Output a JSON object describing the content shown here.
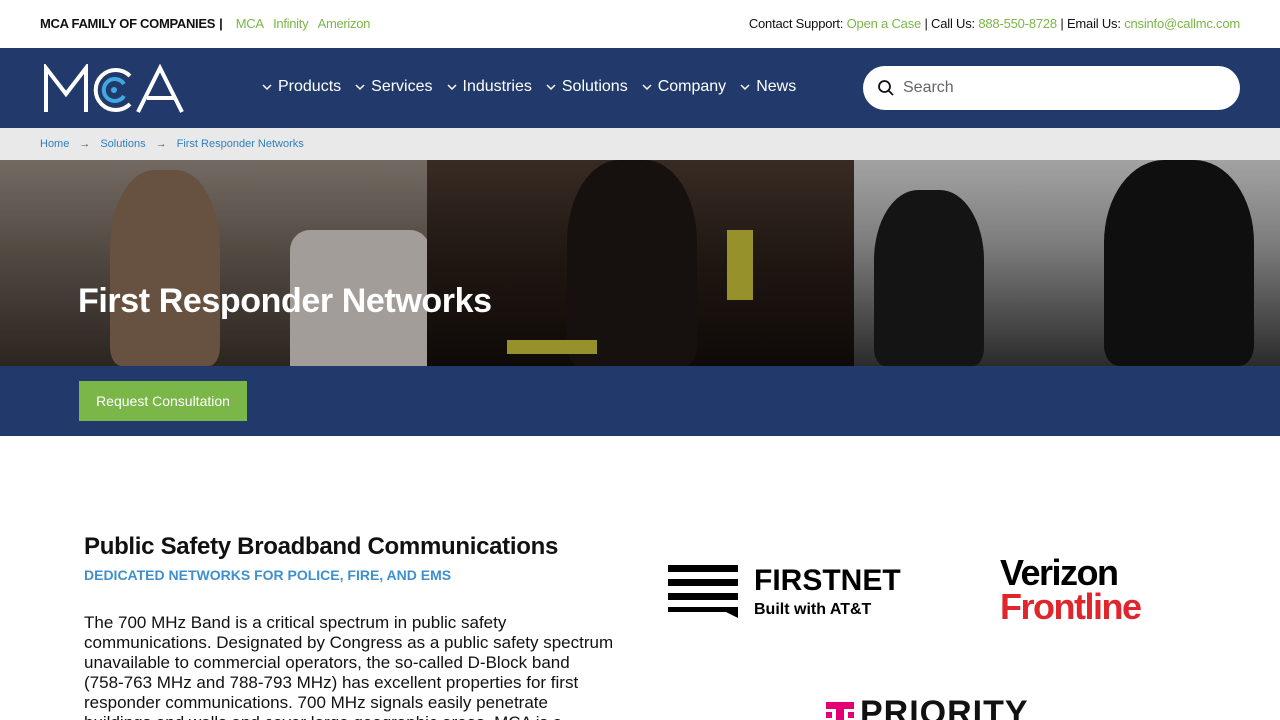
{
  "topbar": {
    "family_label": "MCA FAMILY OF COMPANIES",
    "separator": "|",
    "sister_companies": [
      "MCA",
      "Infinity",
      "Amerizon"
    ],
    "contact_support_label": "Contact Support:",
    "open_case": "Open a Case",
    "call_label": "| Call Us:",
    "phone": "888-550-8728",
    "email_label": "| Email Us:",
    "email": "cnsinfo@callmc.com"
  },
  "header": {
    "logo_text": "MCA",
    "nav": [
      {
        "label": "Products",
        "has_dropdown": true
      },
      {
        "label": "Services",
        "has_dropdown": true
      },
      {
        "label": "Industries",
        "has_dropdown": true
      },
      {
        "label": "Solutions",
        "has_dropdown": true
      },
      {
        "label": "Company",
        "has_dropdown": true
      },
      {
        "label": "News",
        "has_dropdown": false
      }
    ],
    "search_placeholder": "Search",
    "search_icon": "search-icon"
  },
  "breadcrumb": {
    "items": [
      "Home",
      "Solutions",
      "First Responder Networks"
    ],
    "separator": "→"
  },
  "hero": {
    "title": "First Responder Networks"
  },
  "cta": {
    "label": "Request Consultation"
  },
  "content": {
    "heading": "Public Safety Broadband Communications",
    "subheading": "DEDICATED NETWORKS FOR POLICE, FIRE, AND EMS",
    "body": "The 700 MHz Band is a critical spectrum in public safety communications. Designated by Congress as a public safety spectrum unavailable to commercial operators, the so-called D-Block band (758-763 MHz and 788-793 MHz) has excellent properties for first responder communications. 700 MHz signals easily penetrate buildings and walls and cover large geographic areas. MCA is a licensed dealer of all three"
  },
  "partners": {
    "firstnet": {
      "name": "FIRSTNET",
      "tagline": "Built with AT&T"
    },
    "verizon": {
      "line1": "Verizon",
      "line2": "Frontline"
    },
    "tmobile": {
      "name": "PRIORITY"
    }
  },
  "colors": {
    "navy": "#223a6b",
    "green": "#7ab648",
    "link_blue": "#2f7fbf",
    "verizon_red": "#e0262d",
    "tmobile_magenta": "#e20074"
  }
}
